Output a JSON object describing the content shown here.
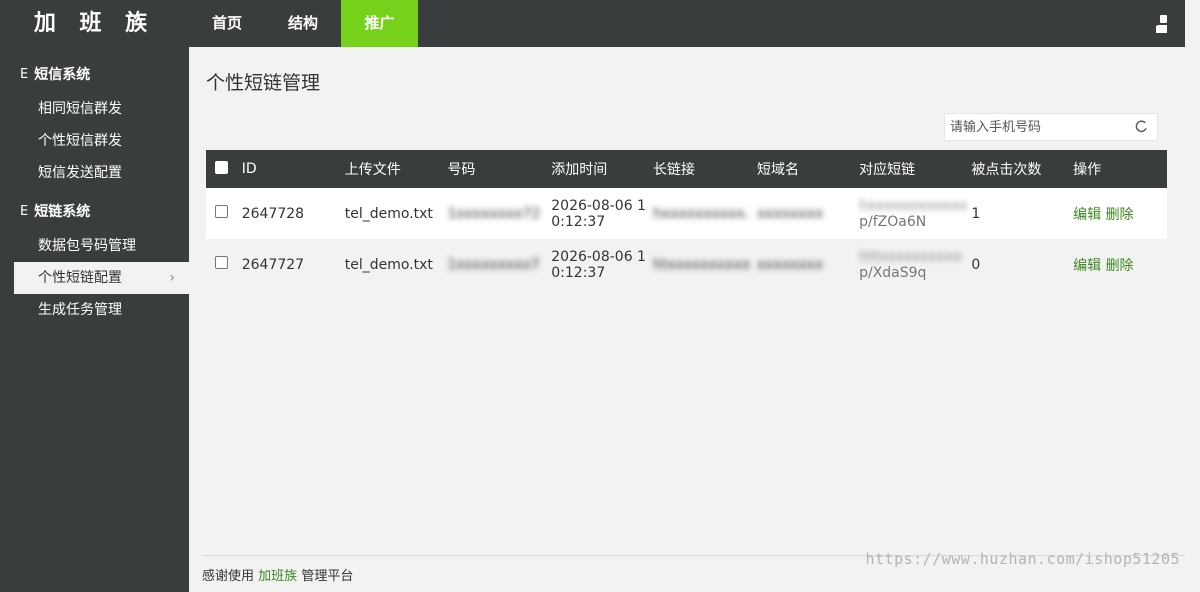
{
  "header": {
    "logo": "加 班 族",
    "nav": [
      {
        "label": "首页"
      },
      {
        "label": "结构"
      },
      {
        "label": "推广"
      }
    ],
    "active_color": "#76d11b",
    "bg_color": "#393d3d"
  },
  "sidebar": {
    "groups": [
      {
        "title": "短信系统",
        "icon": "menu-icon",
        "items": [
          {
            "label": "相同短信群发"
          },
          {
            "label": "个性短信群发"
          },
          {
            "label": "短信发送配置"
          }
        ]
      },
      {
        "title": "短链系统",
        "icon": "menu-icon",
        "items": [
          {
            "label": "数据包号码管理"
          },
          {
            "label": "个性短链配置"
          },
          {
            "label": "生成任务管理"
          }
        ]
      }
    ],
    "active_item": "个性短链配置"
  },
  "main": {
    "title": "个性短链管理",
    "search": {
      "placeholder": "请输入手机号码"
    },
    "table": {
      "headers": [
        "ID",
        "上传文件",
        "号码",
        "添加时间",
        "长链接",
        "短域名",
        "对应短链",
        "被点击次数",
        "操作"
      ],
      "rows": [
        {
          "id": "2647728",
          "file": "tel_demo.txt",
          "phone": "1xxxxxxxx72",
          "time1": "2026-08-06 1",
          "time2": "0:12:37",
          "long": "hxxxxxxxxxx.",
          "domain": "xxxxxxxx",
          "short1": "hxxxxxxxxxxxx",
          "short2": "p/fZOa6N",
          "clicks": "1",
          "edit": "编辑",
          "del": "删除"
        },
        {
          "id": "2647727",
          "file": "tel_demo.txt",
          "phone": "1xxxxxxxxx7",
          "time1": "2026-08-06 1",
          "time2": "0:12:37",
          "long": "htxxxxxxxxxx",
          "domain": "xxxxxxxx",
          "short1": "httxxxxxxxxxx",
          "short2": "p/XdaS9q",
          "clicks": "0",
          "edit": "编辑",
          "del": "删除"
        }
      ]
    }
  },
  "footer": {
    "prefix": "感谢使用",
    "brand": "加班族",
    "suffix": "管理平台",
    "watermark": "https://www.huzhan.com/ishop51205"
  }
}
